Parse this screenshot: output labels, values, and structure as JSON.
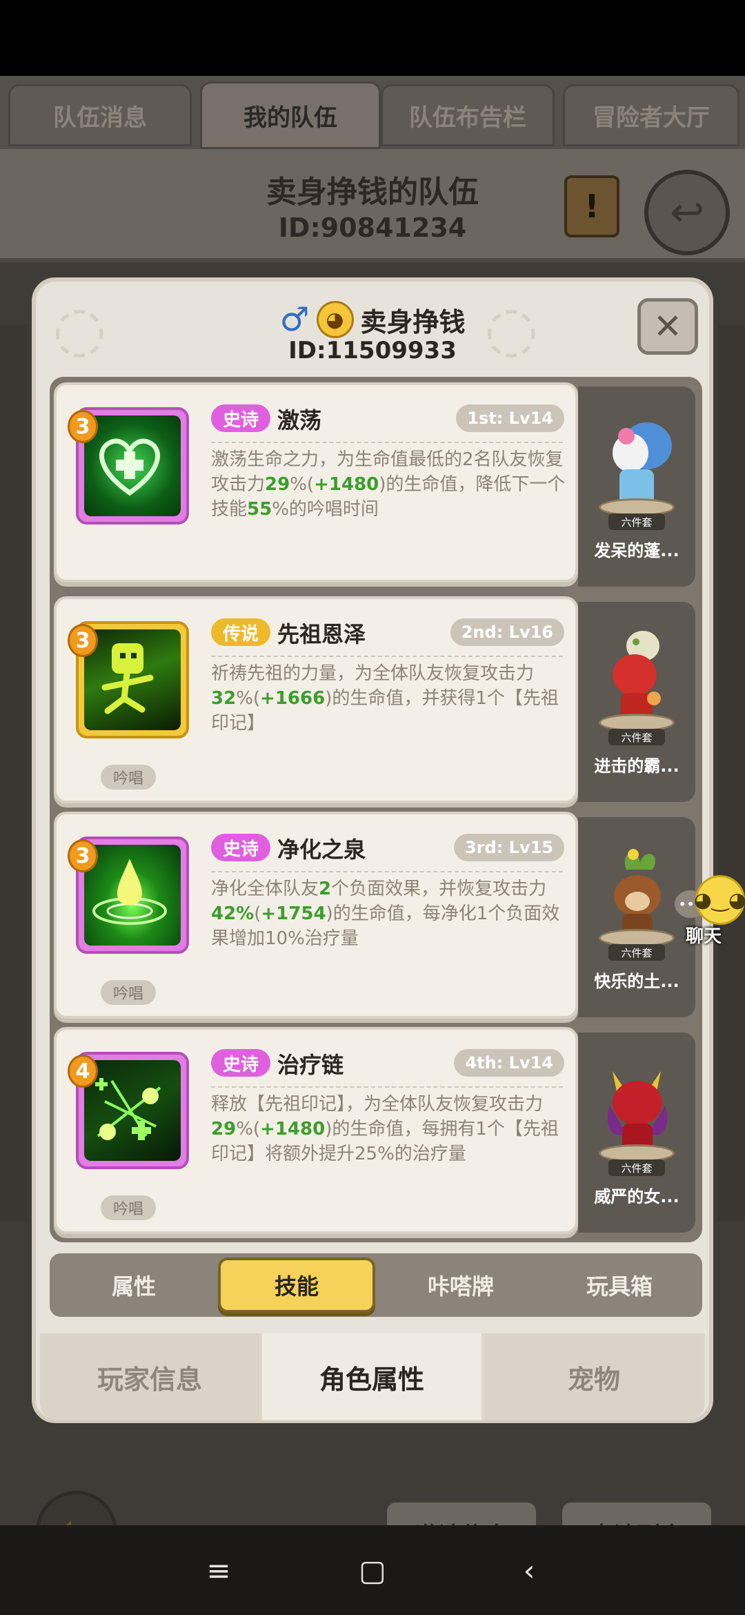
{
  "top_tabs": [
    "队伍消息",
    "我的队伍",
    "队伍布告栏",
    "冒险者大厅"
  ],
  "team": {
    "name": "卖身挣钱的队伍",
    "id": "ID:90841234"
  },
  "player": {
    "gender_icon": "male-icon",
    "name": "卖身挣钱",
    "id": "ID:11509933"
  },
  "skills": [
    {
      "level": "3",
      "rarity": "史诗",
      "name": "激荡",
      "slot": "1st: Lv14",
      "desc_parts": [
        "激荡生命之力，为生命值最低的2名队友恢复攻击力",
        "29",
        "%(",
        "+1480",
        ")的生命值，降低下一个技能",
        "55",
        "%的吟唱时间"
      ],
      "chant": ""
    },
    {
      "level": "3",
      "rarity": "传说",
      "name": "先祖恩泽",
      "slot": "2nd: Lv16",
      "desc_parts": [
        "祈祷先祖的力量，为全体队友恢复攻击力",
        "32",
        "%(",
        "+1666",
        ")的生命值，并获得1个【先祖印记】",
        "",
        ""
      ],
      "chant": "吟唱"
    },
    {
      "level": "3",
      "rarity": "史诗",
      "name": "净化之泉",
      "slot": "3rd: Lv15",
      "desc_parts": [
        "净化全体队友",
        "2",
        "个负面效果，并恢复攻击力",
        "42%",
        "(",
        "+1754",
        ")的生命值，每净化1个负面效果增加10%治疗量"
      ],
      "chant": "吟唱"
    },
    {
      "level": "4",
      "rarity": "史诗",
      "name": "治疗链",
      "slot": "4th: Lv14",
      "desc_parts": [
        "释放【先祖印记】，为全体队友恢复攻击力",
        "29",
        "%(",
        "+1480",
        ")的生命值，每拥有1个【先祖印记】将额外提升25%的治疗量",
        "",
        ""
      ],
      "chant": "吟唱"
    }
  ],
  "costumes": [
    {
      "set": "六件套",
      "name": "发呆的蓬..."
    },
    {
      "set": "六件套",
      "name": "进击的霸..."
    },
    {
      "set": "六件套",
      "name": "快乐的土..."
    },
    {
      "set": "六件套",
      "name": "威严的女..."
    }
  ],
  "inner_tabs": [
    "属性",
    "技能",
    "咔嗒牌",
    "玩具箱"
  ],
  "bottom_tabs": [
    "玩家信息",
    "角色属性",
    "宠物"
  ],
  "chat_label": "聊天",
  "game_buttons": [
    "邀请信息",
    "申请列表"
  ],
  "colors": {
    "epic": "#e05fe0",
    "legend": "#efb92c",
    "highlight": "#3b9e2c"
  }
}
